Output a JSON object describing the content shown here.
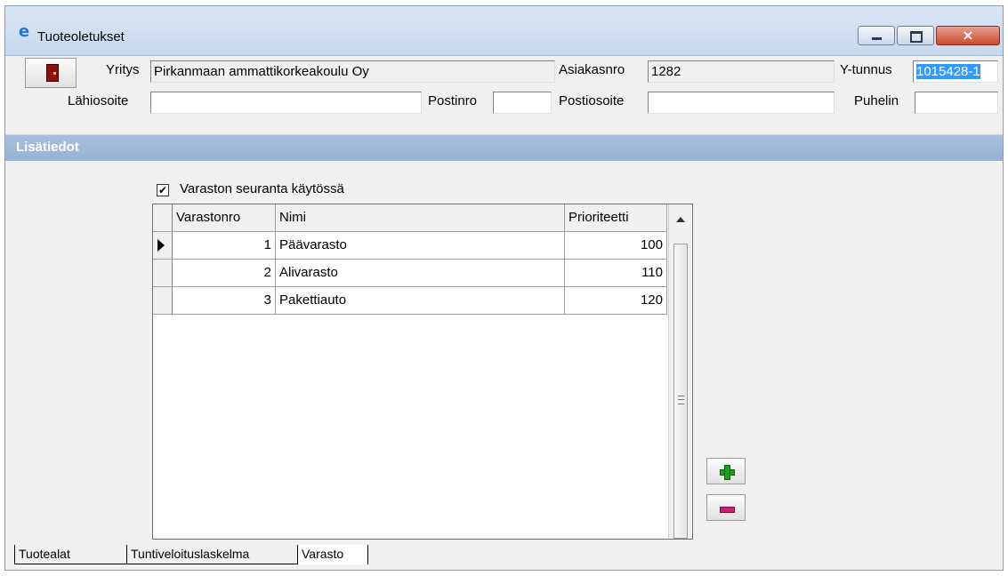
{
  "window": {
    "title": "Tuoteoletukset",
    "icon": "app-e-icon",
    "close_glyph": "×"
  },
  "header": {
    "yritys_label": "Yritys",
    "yritys_value": "Pirkanmaan ammattikorkeakoulu Oy",
    "asiakasnro_label": "Asiakasnro",
    "asiakasnro_value": "1282",
    "ytunnus_label": "Y-tunnus",
    "ytunnus_value": "1015428-1",
    "lahiosoite_label": "Lähiosoite",
    "lahiosoite_value": "",
    "postinro_label": "Postinro",
    "postinro_value": "",
    "postiosoite_label": "Postiosoite",
    "postiosoite_value": "",
    "puhelin_label": "Puhelin",
    "puhelin_value": ""
  },
  "section": {
    "title": "Lisätiedot"
  },
  "checkbox": {
    "label": "Varaston seuranta käytössä",
    "checked": true,
    "mark": "✔"
  },
  "grid": {
    "columns": [
      "Varastonro",
      "Nimi",
      "Prioriteetti"
    ],
    "rows": [
      {
        "nro": "1",
        "nimi": "Päävarasto",
        "prioriteetti": "100"
      },
      {
        "nro": "2",
        "nimi": "Alivarasto",
        "prioriteetti": "110"
      },
      {
        "nro": "3",
        "nimi": "Pakettiauto",
        "prioriteetti": "120"
      }
    ]
  },
  "tabs": [
    "Tuotealat",
    "Tuntiveloituslaskelma",
    "Varasto"
  ],
  "active_tab": "Varasto"
}
